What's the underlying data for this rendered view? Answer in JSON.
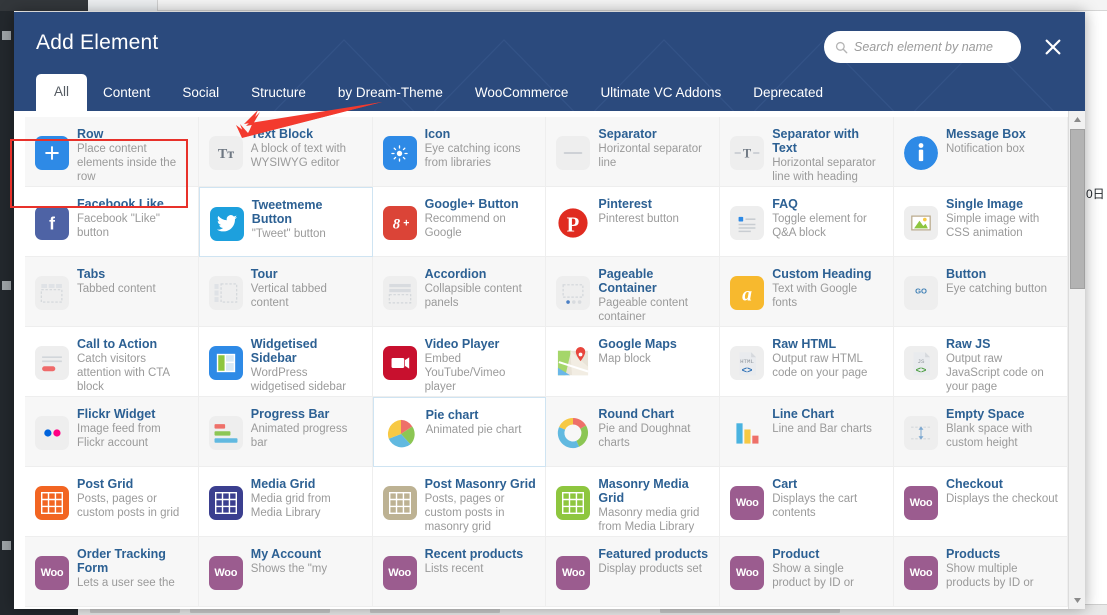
{
  "modal": {
    "title": "Add Element",
    "close_label": "×",
    "search": {
      "placeholder": "Search element by name",
      "value": "",
      "icon": "search-icon"
    },
    "accent_color": "#2b4a7d",
    "link_color": "#2c6093",
    "annotation_color": "#e8312a"
  },
  "tabs": [
    {
      "label": "All",
      "active": true
    },
    {
      "label": "Content",
      "active": false
    },
    {
      "label": "Social",
      "active": false
    },
    {
      "label": "Structure",
      "active": false
    },
    {
      "label": "by Dream-Theme",
      "active": false
    },
    {
      "label": "WooCommerce",
      "active": false
    },
    {
      "label": "Ultimate VC Addons",
      "active": false
    },
    {
      "label": "Deprecated",
      "active": false
    }
  ],
  "elements": [
    {
      "name": "Row",
      "desc": "Place content elements inside the row",
      "icon": "plus-icon",
      "icon_class": "ic-blue",
      "glyph": "+",
      "glyph_class": "glyph",
      "row_style": "shade",
      "highlighted": true
    },
    {
      "name": "Text Block",
      "desc": "A block of text with WYSIWYG editor",
      "icon": "text-block-icon",
      "icon_class": "ic-grey",
      "glyph": "Tᴛ",
      "glyph_class": "glyph-dark",
      "row_style": "shade"
    },
    {
      "name": "Icon",
      "desc": "Eye catching icons from libraries",
      "icon": "sun-icon",
      "icon_class": "ic-blue",
      "glyph": "☀",
      "glyph_class": "glyph",
      "row_style": "shade"
    },
    {
      "name": "Separator",
      "desc": "Horizontal separator line",
      "icon": "separator-icon",
      "icon_class": "ic-grey",
      "glyph": "—",
      "glyph_class": "glyph-dark",
      "row_style": "shade"
    },
    {
      "name": "Separator with Text",
      "desc": "Horizontal separator line with heading",
      "icon": "separator-with-text-icon",
      "icon_class": "ic-grey",
      "glyph": "-T-",
      "glyph_class": "glyph-dark",
      "row_style": "shade"
    },
    {
      "name": "Message Box",
      "desc": "Notification box",
      "icon": "info-circle-icon",
      "icon_class": "ic-blue",
      "glyph": "i",
      "glyph_class": "glyph",
      "row_style": "shade",
      "round": true
    },
    {
      "name": "Facebook Like",
      "desc": "Facebook \"Like\" button",
      "icon": "facebook-icon",
      "icon_class": "ic-fb",
      "glyph": "f",
      "glyph_class": "glyph",
      "row_style": "plain"
    },
    {
      "name": "Tweetmeme Button",
      "desc": "\"Tweet\" button",
      "icon": "twitter-icon",
      "icon_class": "ic-tw",
      "glyph": "ᴠ",
      "glyph_class": "glyph",
      "row_style": "hover"
    },
    {
      "name": "Google+ Button",
      "desc": "Recommend on Google",
      "icon": "google-plus-icon",
      "icon_class": "ic-gplus",
      "glyph": "8+",
      "glyph_class": "glyph",
      "row_style": "plain"
    },
    {
      "name": "Pinterest",
      "desc": "Pinterest button",
      "icon": "pinterest-icon",
      "icon_class": "ic-pin",
      "glyph": "P",
      "glyph_class": "glyph",
      "row_style": "plain"
    },
    {
      "name": "FAQ",
      "desc": "Toggle element for Q&A block",
      "icon": "faq-icon",
      "icon_class": "ic-grey",
      "glyph": "≡",
      "glyph_class": "glyph-dark",
      "row_style": "plain"
    },
    {
      "name": "Single Image",
      "desc": "Simple image with CSS animation",
      "icon": "image-icon",
      "icon_class": "ic-grey",
      "glyph": "⛰",
      "glyph_class": "glyph-dark",
      "row_style": "plain"
    },
    {
      "name": "Tabs",
      "desc": "Tabbed content",
      "icon": "tabs-icon",
      "icon_class": "ic-grey",
      "glyph": "⌸",
      "glyph_class": "glyph-dark",
      "row_style": "shade"
    },
    {
      "name": "Tour",
      "desc": "Vertical tabbed content",
      "icon": "tour-icon",
      "icon_class": "ic-grey",
      "glyph": "▦",
      "glyph_class": "glyph-dark",
      "row_style": "shade"
    },
    {
      "name": "Accordion",
      "desc": "Collapsible content panels",
      "icon": "accordion-icon",
      "icon_class": "ic-grey",
      "glyph": "☰",
      "glyph_class": "glyph-dark",
      "row_style": "shade"
    },
    {
      "name": "Pageable Container",
      "desc": "Pageable content container",
      "icon": "pageable-container-icon",
      "icon_class": "ic-grey",
      "glyph": "▭",
      "glyph_class": "glyph-dark",
      "row_style": "shade"
    },
    {
      "name": "Custom Heading",
      "desc": "Text with Google fonts",
      "icon": "custom-heading-icon",
      "icon_class": "ic-amber",
      "glyph": "a",
      "glyph_class": "glyph",
      "row_style": "shade"
    },
    {
      "name": "Button",
      "desc": "Eye catching button",
      "icon": "go-button-icon",
      "icon_class": "ic-grey",
      "glyph": "GO",
      "glyph_class": "glyph-dark",
      "row_style": "shade"
    },
    {
      "name": "Call to Action",
      "desc": "Catch visitors attention with CTA block",
      "icon": "call-to-action-icon",
      "icon_class": "ic-grey",
      "glyph": "≡",
      "glyph_class": "glyph-dark",
      "row_style": "plain"
    },
    {
      "name": "Widgetised Sidebar",
      "desc": "WordPress widgetised sidebar",
      "icon": "sidebar-layout-icon",
      "icon_class": "ic-blue",
      "glyph": "▣",
      "glyph_class": "glyph",
      "row_style": "plain"
    },
    {
      "name": "Video Player",
      "desc": "Embed YouTube/Vimeo player",
      "icon": "video-player-icon",
      "icon_class": "ic-red",
      "glyph": "▶",
      "glyph_class": "glyph",
      "row_style": "plain"
    },
    {
      "name": "Google Maps",
      "desc": "Map block",
      "icon": "google-maps-icon",
      "icon_class": "ic-white",
      "glyph": "●",
      "glyph_class": "glyph",
      "row_style": "plain"
    },
    {
      "name": "Raw HTML",
      "desc": "Output raw HTML code on your page",
      "icon": "raw-html-icon",
      "icon_class": "ic-grey",
      "glyph": "<>",
      "glyph_class": "glyph-dark",
      "row_style": "plain"
    },
    {
      "name": "Raw JS",
      "desc": "Output raw JavaScript code on your page",
      "icon": "raw-js-icon",
      "icon_class": "ic-grey",
      "glyph": "<>",
      "glyph_class": "glyph-dark",
      "row_style": "plain"
    },
    {
      "name": "Flickr Widget",
      "desc": "Image feed from Flickr account",
      "icon": "flickr-icon",
      "icon_class": "ic-grey",
      "glyph": "●●",
      "glyph_class": "glyph-dark",
      "row_style": "shade"
    },
    {
      "name": "Progress Bar",
      "desc": "Animated progress bar",
      "icon": "progress-bar-icon",
      "icon_class": "ic-grey",
      "glyph": "≡",
      "glyph_class": "glyph-dark",
      "row_style": "shade"
    },
    {
      "name": "Pie chart",
      "desc": "Animated pie chart",
      "icon": "pie-chart-icon",
      "icon_class": "ic-white",
      "glyph": "◕",
      "glyph_class": "glyph",
      "row_style": "hover"
    },
    {
      "name": "Round Chart",
      "desc": "Pie and Doughnat charts",
      "icon": "round-chart-icon",
      "icon_class": "ic-white",
      "glyph": "○",
      "glyph_class": "glyph",
      "row_style": "shade"
    },
    {
      "name": "Line Chart",
      "desc": "Line and Bar charts",
      "icon": "bar-chart-icon",
      "icon_class": "ic-white",
      "glyph": "█",
      "glyph_class": "glyph",
      "row_style": "shade"
    },
    {
      "name": "Empty Space",
      "desc": "Blank space with custom height",
      "icon": "empty-space-icon",
      "icon_class": "ic-grey",
      "glyph": "↕",
      "glyph_class": "glyph-dark",
      "row_style": "shade"
    },
    {
      "name": "Post Grid",
      "desc": "Posts, pages or custom posts in grid",
      "icon": "post-grid-icon",
      "icon_class": "ic-orange",
      "glyph": "⌗",
      "glyph_class": "glyph",
      "row_style": "plain"
    },
    {
      "name": "Media Grid",
      "desc": "Media grid from Media Library",
      "icon": "media-grid-icon",
      "icon_class": "ic-navy",
      "glyph": "⌗",
      "glyph_class": "glyph",
      "row_style": "plain"
    },
    {
      "name": "Post Masonry Grid",
      "desc": "Posts, pages or custom posts in masonry grid",
      "icon": "post-masonry-grid-icon",
      "icon_class": "ic-khaki",
      "glyph": "⌗",
      "glyph_class": "glyph",
      "row_style": "plain"
    },
    {
      "name": "Masonry Media Grid",
      "desc": "Masonry media grid from Media Library",
      "icon": "masonry-media-grid-icon",
      "icon_class": "ic-lime",
      "glyph": "⌗",
      "glyph_class": "glyph",
      "row_style": "plain"
    },
    {
      "name": "Cart",
      "desc": "Displays the cart contents",
      "icon": "woocommerce-icon",
      "icon_class": "ic-woo",
      "glyph": "Woo",
      "glyph_class": "woo-txt",
      "row_style": "plain"
    },
    {
      "name": "Checkout",
      "desc": "Displays the checkout",
      "icon": "woocommerce-icon",
      "icon_class": "ic-woo",
      "glyph": "Woo",
      "glyph_class": "woo-txt",
      "row_style": "plain"
    },
    {
      "name": "Order Tracking Form",
      "desc": "Lets a user see the",
      "icon": "woocommerce-icon",
      "icon_class": "ic-woo",
      "glyph": "Woo",
      "glyph_class": "woo-txt",
      "row_style": "shade"
    },
    {
      "name": "My Account",
      "desc": "Shows the \"my",
      "icon": "woocommerce-icon",
      "icon_class": "ic-woo",
      "glyph": "Woo",
      "glyph_class": "woo-txt",
      "row_style": "shade"
    },
    {
      "name": "Recent products",
      "desc": "Lists recent",
      "icon": "woocommerce-icon",
      "icon_class": "ic-woo",
      "glyph": "Woo",
      "glyph_class": "woo-txt",
      "row_style": "shade"
    },
    {
      "name": "Featured products",
      "desc": "Display products set",
      "icon": "woocommerce-icon",
      "icon_class": "ic-woo",
      "glyph": "Woo",
      "glyph_class": "woo-txt",
      "row_style": "shade"
    },
    {
      "name": "Product",
      "desc": "Show a single product by ID or",
      "icon": "woocommerce-icon",
      "icon_class": "ic-woo",
      "glyph": "Woo",
      "glyph_class": "woo-txt",
      "row_style": "shade"
    },
    {
      "name": "Products",
      "desc": "Show multiple products by ID or",
      "icon": "woocommerce-icon",
      "icon_class": "ic-woo",
      "glyph": "Woo",
      "glyph_class": "woo-txt",
      "row_style": "shade"
    }
  ],
  "background": {
    "right_panel_text": "0日"
  }
}
